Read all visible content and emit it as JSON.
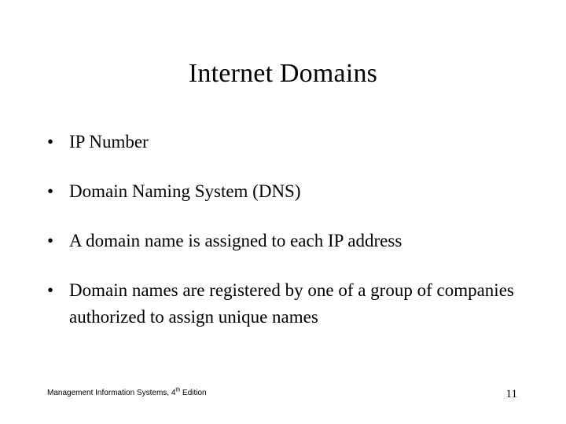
{
  "slide": {
    "title": "Internet Domains",
    "bullet_marker": "•",
    "bullets": [
      {
        "text": "IP Number"
      },
      {
        "text": "Domain Naming System (DNS)"
      },
      {
        "text": "A domain name is assigned to each IP address"
      },
      {
        "text": "Domain names are registered by one of a group of companies authorized to assign unique names"
      }
    ],
    "footer": {
      "text_before": "Management Information Systems, 4",
      "ordinal_suffix": "th",
      "text_after": " Edition"
    },
    "page_number": "11",
    "colors": {
      "background": "#ffffff",
      "text": "#000000"
    }
  }
}
